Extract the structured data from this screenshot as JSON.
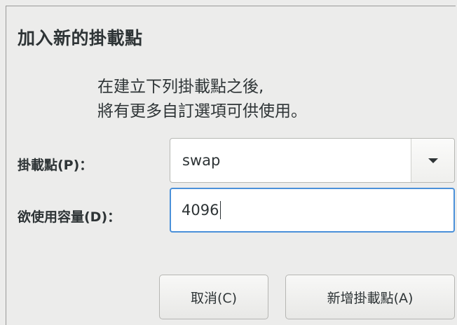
{
  "dialog": {
    "title": "加入新的掛載點",
    "info_line1": "在建立下列掛載點之後,",
    "info_line2": "將有更多自訂選項可供使用。"
  },
  "form": {
    "mount_point_label": "掛載點(P)：",
    "mount_point_value": "swap",
    "capacity_label": "欲使用容量(D)：",
    "capacity_value": "4096"
  },
  "buttons": {
    "cancel": "取消(C)",
    "add": "新增掛載點(A)"
  },
  "colors": {
    "focus_border": "#4a90d9",
    "background": "#ececeb"
  }
}
